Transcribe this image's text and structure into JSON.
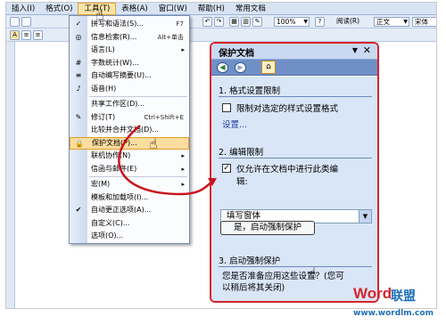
{
  "menubar": {
    "items": [
      "插入(I)",
      "格式(O)",
      "工具(T)",
      "表格(A)",
      "窗口(W)",
      "帮助(H)",
      "常用文档"
    ],
    "active_index": 2
  },
  "toolbar": {
    "zoom": "100%",
    "read_label": "阅读(R)",
    "style": "正文",
    "font": "宋体",
    "left_marker": "A"
  },
  "tools_menu": {
    "items": [
      {
        "label": "拼写和语法(S)...",
        "shortcut": "F7",
        "icon": "spell-check-icon"
      },
      {
        "label": "信息检索(R)...",
        "shortcut": "Alt+单击",
        "icon": "research-icon"
      },
      {
        "label": "语言(L)",
        "arrow": "▸"
      },
      {
        "label": "字数统计(W)...",
        "icon": "word-count-icon"
      },
      {
        "label": "自动编写摘要(U)...",
        "icon": "autosummarize-icon"
      },
      {
        "label": "语音(H)",
        "icon": "speech-icon"
      },
      {
        "label": "共享工作区(D)...",
        "separator_before": true
      },
      {
        "label": "修订(T)",
        "shortcut": "Ctrl+Shift+E",
        "icon": "track-changes-icon"
      },
      {
        "label": "比较并合并文档(D)..."
      },
      {
        "label": "保护文档(P)...",
        "icon": "protect-document-icon",
        "highlighted": true
      },
      {
        "label": "联机协作(N)",
        "arrow": "▸"
      },
      {
        "label": "信函与邮件(E)",
        "arrow": "▸"
      },
      {
        "label": "宏(M)",
        "arrow": "▸",
        "separator_before": true
      },
      {
        "label": "模板和加载项(I)..."
      },
      {
        "label": "自动更正选项(A)...",
        "icon": "autocorrect-icon"
      },
      {
        "label": "自定义(C)..."
      },
      {
        "label": "选项(O)..."
      }
    ]
  },
  "panel": {
    "title": "保护文档",
    "dropdown_glyph": "▼",
    "close_glyph": "✕",
    "section1": {
      "heading": "1. 格式设置限制",
      "checkbox_label": "限制对选定的样式设置格式",
      "checked": false,
      "link": "设置..."
    },
    "section2": {
      "heading": "2. 编辑限制",
      "checkbox_label_line1": "仅允许在文档中进行此类编",
      "checkbox_label_line2": "辑:",
      "checked": true,
      "select_value": "填写窗体"
    },
    "section3": {
      "heading": "3. 启动强制保护",
      "question_line1": "您是否准备应用这些设置？(您可",
      "question_line2": "以稍后将其关闭)",
      "button_label": "是，启动强制保护"
    }
  },
  "watermark": {
    "logo_part1": "Word",
    "logo_part2": "联盟",
    "url": "www.wordlm.com"
  },
  "colors": {
    "highlight_border": "#d8242c",
    "panel_bg": "#d9e6f7",
    "menu_highlight": "#fbdd9f"
  }
}
